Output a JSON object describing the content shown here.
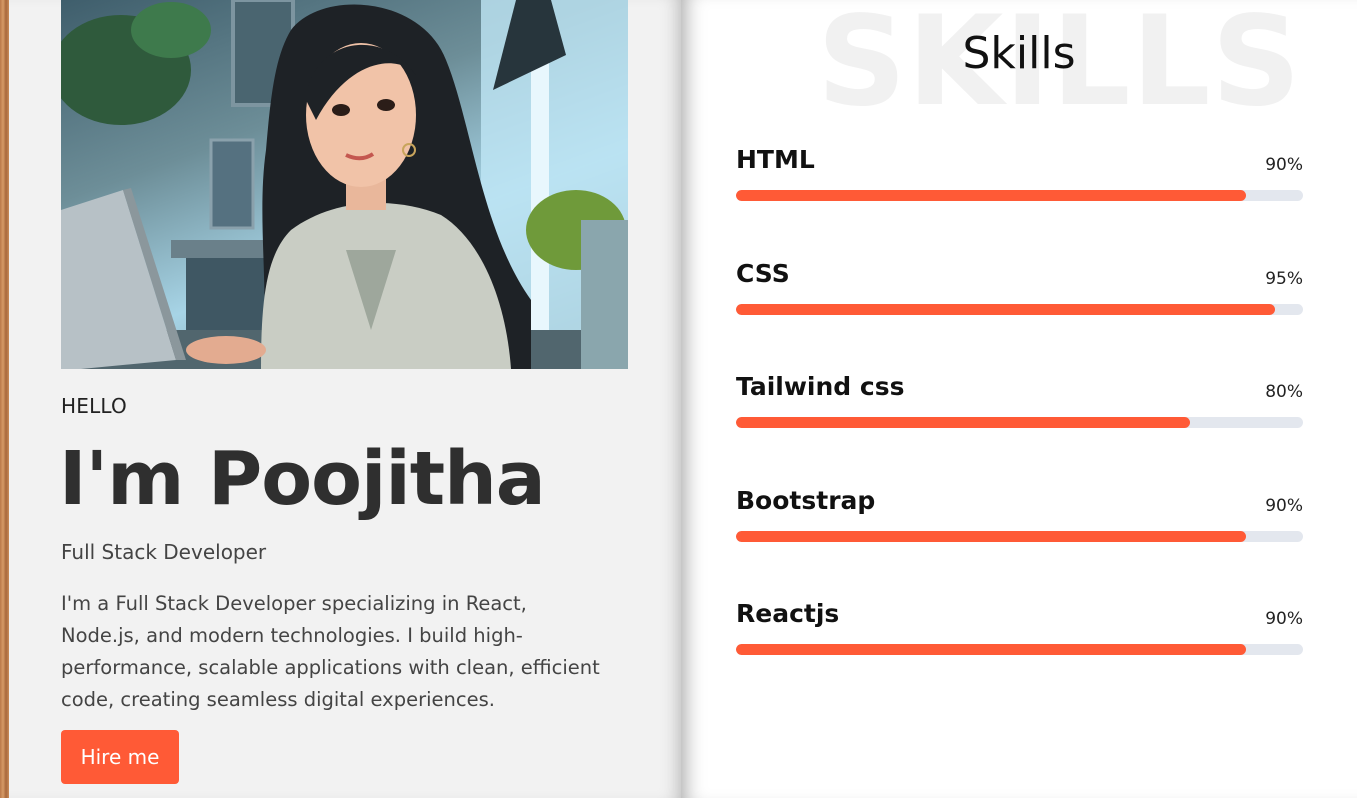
{
  "intro": {
    "greeting": "HELLO",
    "name": "I'm Poojitha",
    "role": "Full Stack Developer",
    "bio": "I'm a Full Stack Developer specializing in React, Node.js, and modern technologies. I build high-performance, scalable applications with clean, efficient code, creating seamless digital experiences.",
    "hire_label": "Hire me",
    "photo_icon": "portrait-image"
  },
  "skills": {
    "watermark": "SKILLS",
    "title": "Skills",
    "items": [
      {
        "label": "HTML",
        "percent_text": "90%",
        "level": 90
      },
      {
        "label": "CSS",
        "percent_text": "95%",
        "level": 95
      },
      {
        "label": "Tailwind css",
        "percent_text": "80%",
        "level": 80
      },
      {
        "label": "Bootstrap",
        "percent_text": "90%",
        "level": 90
      },
      {
        "label": "Reactjs",
        "percent_text": "90%",
        "level": 90
      }
    ]
  },
  "colors": {
    "accent": "#ff5a36",
    "track": "#e3e7ee",
    "left_page": "#f2f2f2",
    "right_page": "#ffffff"
  }
}
